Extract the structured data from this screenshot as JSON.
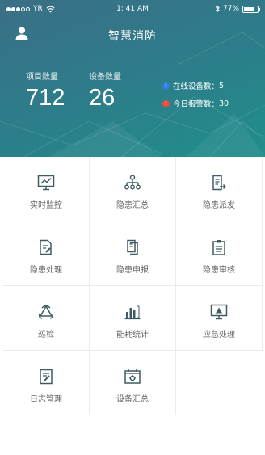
{
  "status_bar": {
    "carrier": "YR",
    "time": "1: 41 AM",
    "battery": "77%",
    "battery_level": 0.77
  },
  "header": {
    "title": "智慧消防"
  },
  "stats": [
    {
      "label": "项目数量",
      "value": "712"
    },
    {
      "label": "设备数量",
      "value": "26"
    }
  ],
  "info": [
    {
      "label": "在线设备数：",
      "value": "5",
      "color": "#2f7fe0"
    },
    {
      "label": "今日报警数：",
      "value": "30",
      "color": "#e74c3c"
    }
  ],
  "menu": [
    {
      "label": "实时监控",
      "icon": "monitor-chart-icon"
    },
    {
      "label": "隐患汇总",
      "icon": "hierarchy-icon"
    },
    {
      "label": "隐患派发",
      "icon": "document-send-icon"
    },
    {
      "label": "隐患处理",
      "icon": "document-edit-icon"
    },
    {
      "label": "隐患申报",
      "icon": "document-copy-icon"
    },
    {
      "label": "隐患审核",
      "icon": "clipboard-icon"
    },
    {
      "label": "巡检",
      "icon": "triangle-cycle-icon"
    },
    {
      "label": "能耗统计",
      "icon": "bar-chart-icon"
    },
    {
      "label": "应急处理",
      "icon": "monitor-warning-icon"
    },
    {
      "label": "日志管理",
      "icon": "log-edit-icon"
    },
    {
      "label": "设备汇总",
      "icon": "device-gear-icon"
    }
  ],
  "colors": {
    "icon": "#3e5c63",
    "label": "#666666"
  }
}
